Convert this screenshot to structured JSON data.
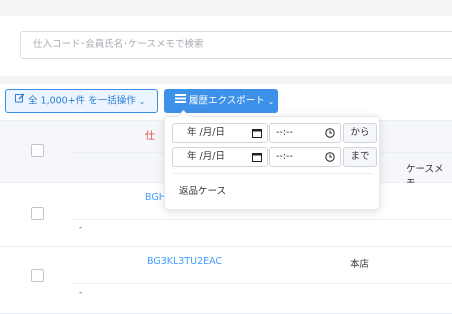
{
  "search": {
    "placeholder": "仕入コード･会員氏名･ケースメモで検索"
  },
  "toolbar": {
    "bulk_label": "全 1,000+件 を一括操作",
    "export_label": "履歴エクスポート"
  },
  "table": {
    "header_partial": "仕",
    "case_memo_header": "ケースメモ"
  },
  "rows": [
    {
      "code": "BGH",
      "store": "",
      "memo": "-"
    },
    {
      "code": "BG3KL3TU2EAC",
      "store": "本店",
      "memo": "-"
    }
  ],
  "export_menu": {
    "date_placeholder": "年 /月/日",
    "time_placeholder": "--:--",
    "from_label": "から",
    "to_label": "まで",
    "item_return_case": "返品ケース"
  },
  "colors": {
    "accent": "#409eff",
    "header_red": "#e04a3a",
    "background": "#f4f5f7"
  }
}
